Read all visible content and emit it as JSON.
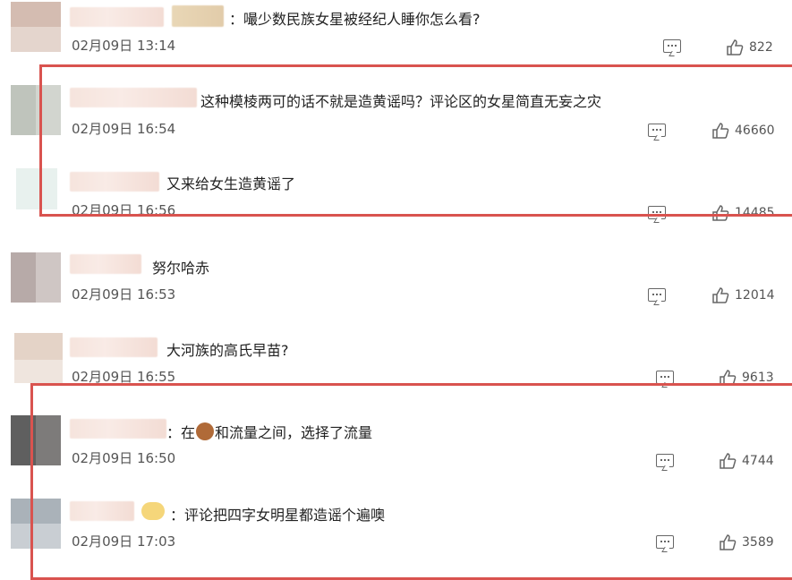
{
  "comments": [
    {
      "text": "：嘬少数民族女星被经纪人睡你怎么看?",
      "date": "02月09日 13:14",
      "likes": "822"
    },
    {
      "text": "这种模棱两可的话不就是造黄谣吗？评论区的女星简直无妄之灾",
      "date": "02月09日 16:54",
      "likes": "46660"
    },
    {
      "text": "又来给女生造黄谣了",
      "date": "02月09日 16:56",
      "likes": "14485"
    },
    {
      "text": "努尔哈赤",
      "date": "02月09日 16:53",
      "likes": "12014"
    },
    {
      "text": "大河族的高氏早苗?",
      "date": "02月09日 16:55",
      "likes": "9613"
    },
    {
      "text_before": "在",
      "text_after": "和流量之间，选择了流量",
      "date": "02月09日 16:50",
      "likes": "4744"
    },
    {
      "text": "评论把四字女明星都造谣个遍噢",
      "date": "02月09日 17:03",
      "likes": "3589"
    }
  ],
  "colors": {
    "highlight_box": "#d9534f"
  },
  "icons": {
    "reply": "comment-icon",
    "like": "thumbs-up-icon"
  }
}
